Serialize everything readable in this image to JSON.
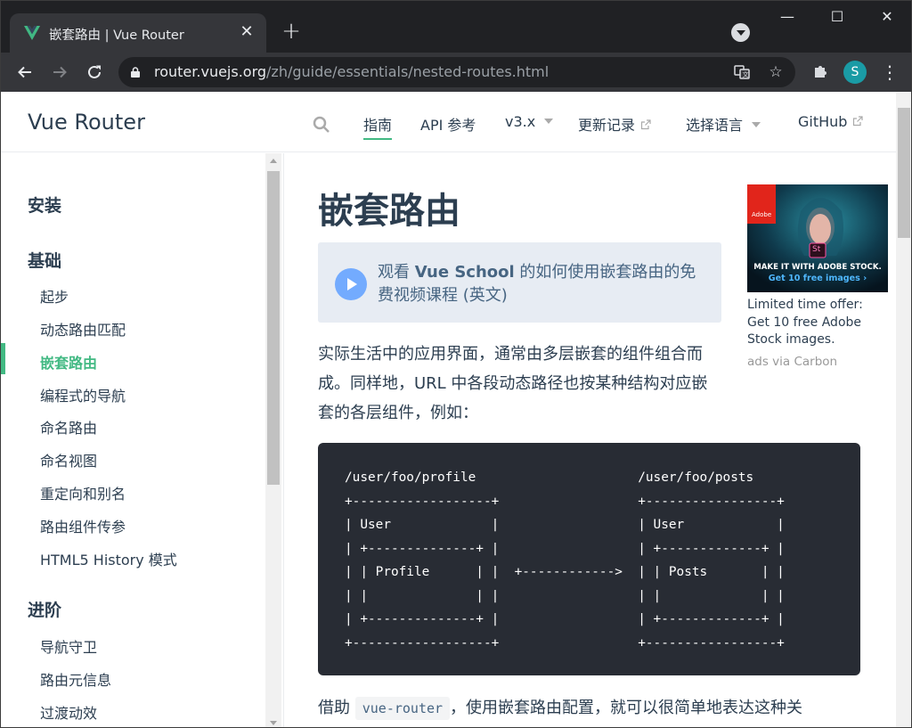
{
  "browser": {
    "tab_title": "嵌套路由 | Vue Router",
    "tab_close": "✕",
    "new_tab": "+",
    "url_host": "router.vuejs.org",
    "url_path": "/zh/guide/essentials/nested-routes.html",
    "profile_initial": "S",
    "window_controls": {
      "minimize": "—",
      "maximize": "☐",
      "close": "✕"
    }
  },
  "site": {
    "name": "Vue Router",
    "nav": {
      "guide": "指南",
      "api": "API 参考",
      "version": "v3.x",
      "changelog": "更新记录",
      "language": "选择语言",
      "github": "GitHub"
    }
  },
  "sidebar": {
    "groups": [
      {
        "label": "安装"
      },
      {
        "label": "基础"
      },
      {
        "label": "进阶"
      }
    ],
    "basics_items": [
      {
        "label": "起步"
      },
      {
        "label": "动态路由匹配"
      },
      {
        "label": "嵌套路由",
        "active": true
      },
      {
        "label": "编程式的导航"
      },
      {
        "label": "命名路由"
      },
      {
        "label": "命名视图"
      },
      {
        "label": "重定向和别名"
      },
      {
        "label": "路由组件传参"
      },
      {
        "label": "HTML5 History 模式"
      }
    ],
    "advanced_items": [
      {
        "label": "导航守卫"
      },
      {
        "label": "路由元信息"
      },
      {
        "label": "过渡动效"
      }
    ]
  },
  "content": {
    "title": "嵌套路由",
    "vue_school_prefix": "观看 ",
    "vue_school_strong": "Vue School",
    "vue_school_suffix": " 的如何使用嵌套路由的免费视频课程 (英文)",
    "para1": "实际生活中的应用界面，通常由多层嵌套的组件组合而成。同样地，URL 中各段动态路径也按某种结构对应嵌套的各层组件，例如：",
    "code": "/user/foo/profile                     /user/foo/posts\n+------------------+                  +-----------------+\n| User             |                  | User            |\n| +--------------+ |                  | +-------------+ |\n| | Profile      | |  +------------>  | | Posts       | |\n| |              | |                  | |             | |\n| +--------------+ |                  | +-------------+ |\n+------------------+                  +-----------------+",
    "para2_before": "借助 ",
    "para2_code": "vue-router",
    "para2_after": "，使用嵌套路由配置，就可以很简单地表达这种关"
  },
  "ad": {
    "image_caption": "MAKE IT WITH ADOBE STOCK.",
    "image_cta": "Get 10 free images ›",
    "brand": "Adobe",
    "badge": "St",
    "text": "Limited time offer: Get 10 free Adobe Stock images.",
    "via": "ads via Carbon"
  }
}
